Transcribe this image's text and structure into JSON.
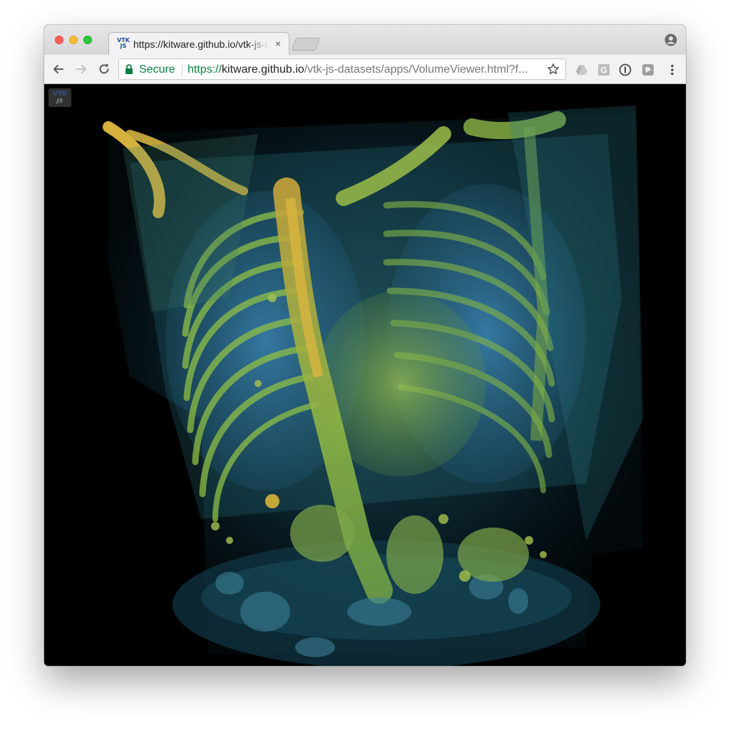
{
  "browser": {
    "tab": {
      "favicon_text_top": "VTK",
      "favicon_text_bottom": "JS",
      "title": "https://kitware.github.io/vtk-js-datasets/apps/VolumeViewer.html",
      "close_glyph": "×"
    },
    "toolbar": {
      "back_icon": "back-arrow-icon",
      "forward_icon": "forward-arrow-icon",
      "reload_icon": "reload-icon",
      "security_label": "Secure",
      "url_scheme": "https://",
      "url_host": "kitware.github.io",
      "url_path": "/vtk-js-datasets/apps/VolumeViewer.html?f...",
      "bookmark_icon": "star-icon",
      "extensions": [
        "drive-icon",
        "g-extension-icon",
        "password-icon",
        "pocket-icon"
      ],
      "menu_icon": "more-vert-icon"
    },
    "profile_icon": "profile-icon"
  },
  "page": {
    "logo_top": "VTK",
    "logo_bottom": "JS",
    "content": "volume-rendering-ct-chest"
  },
  "colors": {
    "secure_green": "#0b8043",
    "bone_yellow": "#d8b23a",
    "tissue_green": "#8fbf3a",
    "tissue_blue": "#2f7fa8",
    "background": "#000000"
  }
}
